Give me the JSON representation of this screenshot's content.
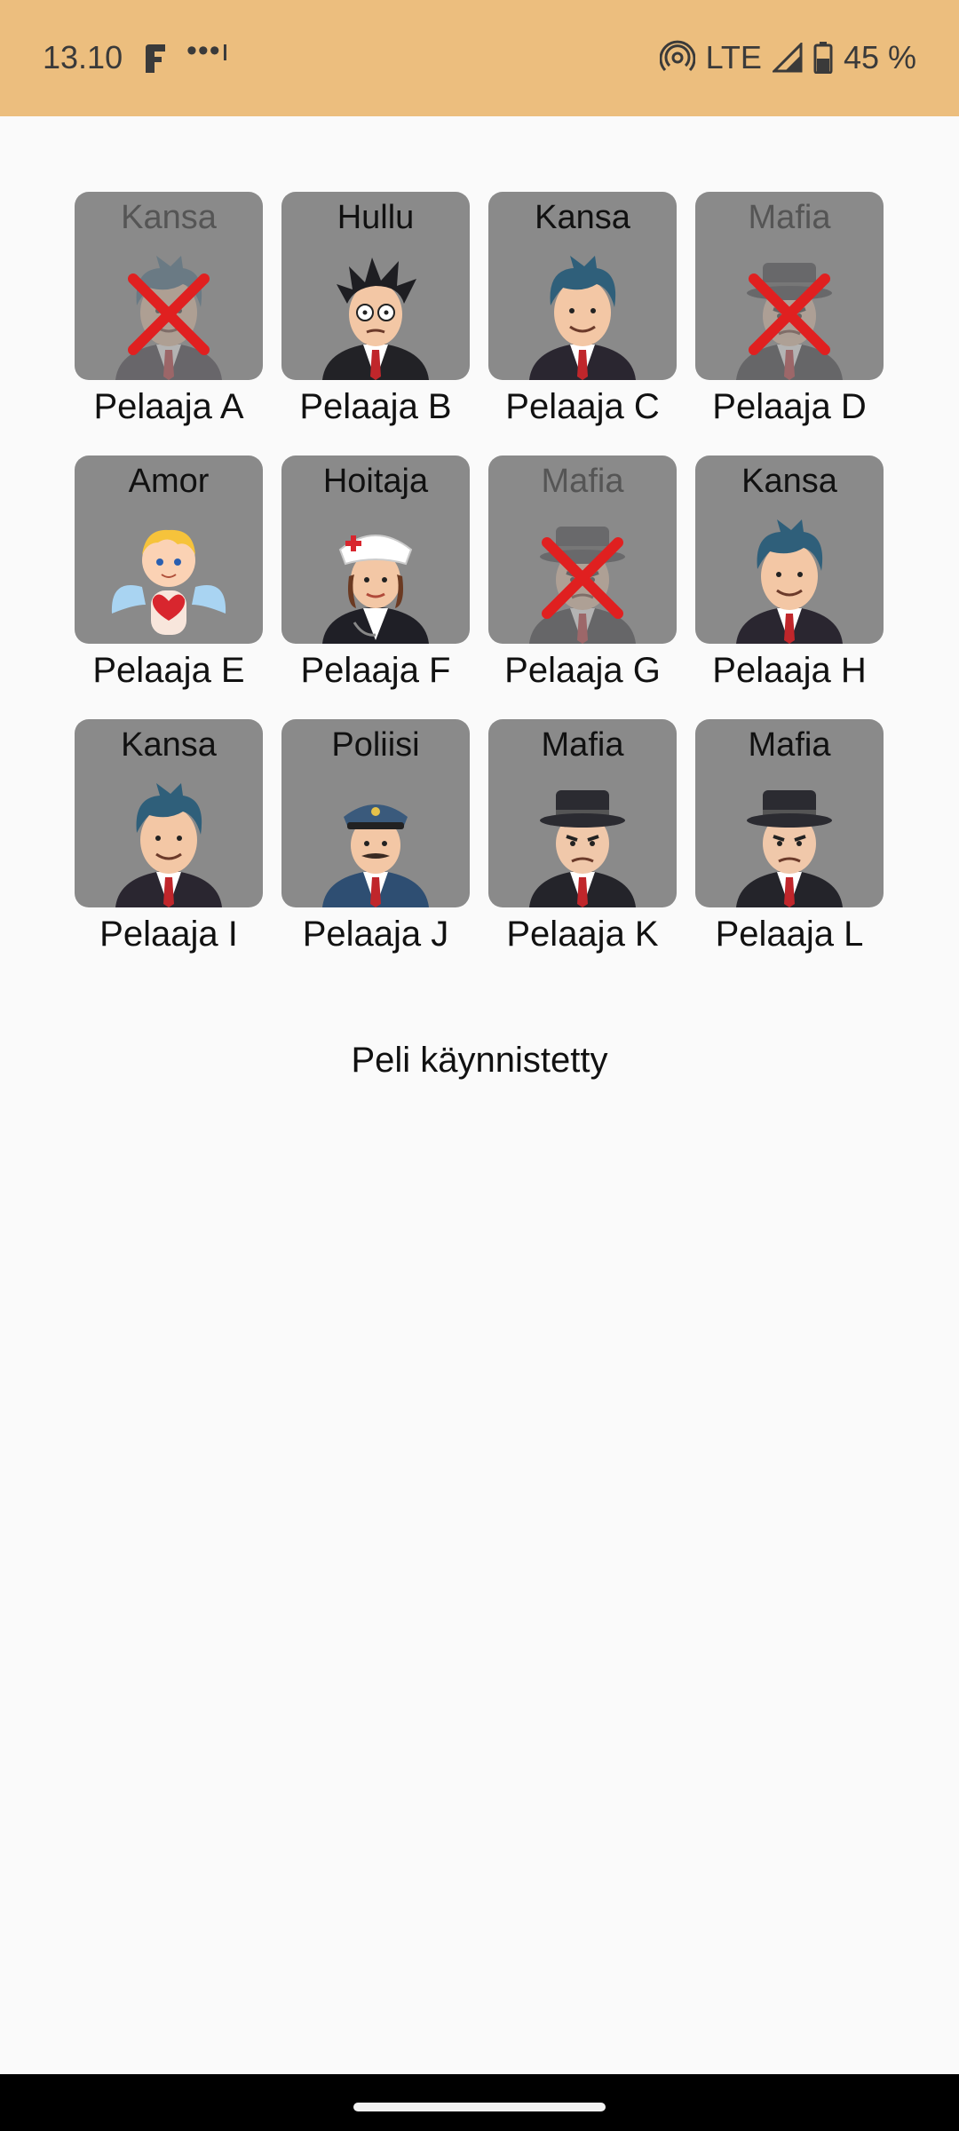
{
  "status_bar": {
    "time": "13.10",
    "dots": "•••ı",
    "network": "LTE",
    "battery": "45 %"
  },
  "players": [
    {
      "name": "Pelaaja A",
      "role": "Kansa",
      "avatar": "citizen-avatar",
      "dead": true
    },
    {
      "name": "Pelaaja B",
      "role": "Hullu",
      "avatar": "madman-avatar",
      "dead": false
    },
    {
      "name": "Pelaaja C",
      "role": "Kansa",
      "avatar": "citizen-avatar",
      "dead": false
    },
    {
      "name": "Pelaaja D",
      "role": "Mafia",
      "avatar": "mafia-avatar",
      "dead": true
    },
    {
      "name": "Pelaaja E",
      "role": "Amor",
      "avatar": "cupid-avatar",
      "dead": false
    },
    {
      "name": "Pelaaja F",
      "role": "Hoitaja",
      "avatar": "nurse-avatar",
      "dead": false
    },
    {
      "name": "Pelaaja G",
      "role": "Mafia",
      "avatar": "mafia-avatar",
      "dead": true
    },
    {
      "name": "Pelaaja H",
      "role": "Kansa",
      "avatar": "citizen-avatar",
      "dead": false
    },
    {
      "name": "Pelaaja I",
      "role": "Kansa",
      "avatar": "citizen-avatar",
      "dead": false
    },
    {
      "name": "Pelaaja J",
      "role": "Poliisi",
      "avatar": "police-avatar",
      "dead": false
    },
    {
      "name": "Pelaaja K",
      "role": "Mafia",
      "avatar": "mafia-avatar",
      "dead": false
    },
    {
      "name": "Pelaaja L",
      "role": "Mafia",
      "avatar": "mafia-avatar",
      "dead": false
    }
  ],
  "status_message": "Peli käynnistetty",
  "colors": {
    "status_bar_bg": "#ecbe7e",
    "card_bg": "#8a8a8a",
    "eliminated_mark": "#e02020"
  }
}
